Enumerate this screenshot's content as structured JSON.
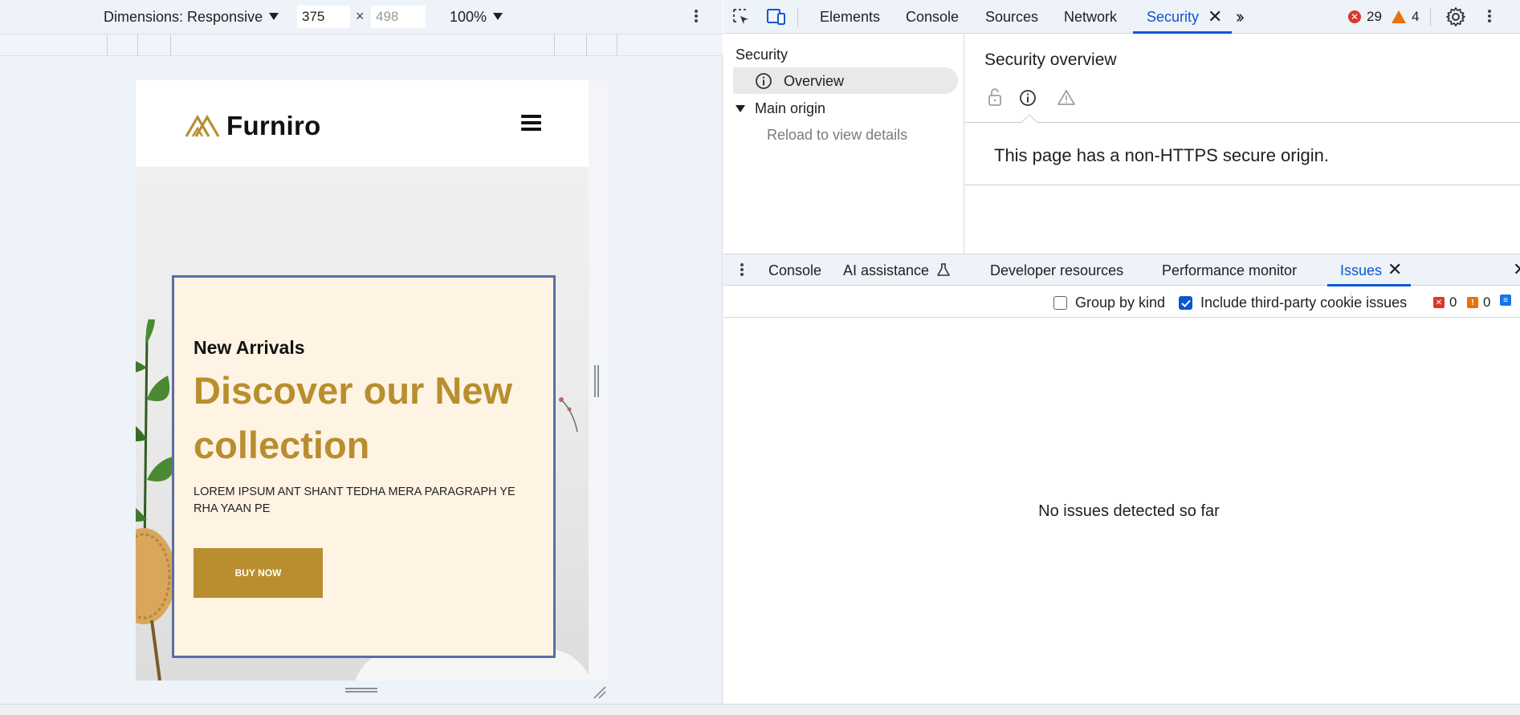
{
  "device_toolbar": {
    "dimensions_label": "Dimensions: Responsive",
    "width_value": "375",
    "height_placeholder": "498",
    "times_sign": "×",
    "zoom_value": "100%"
  },
  "site": {
    "logo_text": "Furniro",
    "brand_color": "#b88e2f",
    "eyebrow": "New Arrivals",
    "headline": "Discover our New collection",
    "description": "LOREM IPSUM ANT SHANT TEDHA MERA PARAGRAPH YE RHA YAAN PE",
    "cta_label": "BUY NOW",
    "card_bg": "#fff3e3",
    "card_border": "#5b6ea3"
  },
  "devtools": {
    "tabs": [
      {
        "label": "Elements"
      },
      {
        "label": "Console"
      },
      {
        "label": "Sources"
      },
      {
        "label": "Network"
      },
      {
        "label": "Security",
        "active": true
      }
    ],
    "error_count": "29",
    "warning_count": "4",
    "accent": "#0b57d0",
    "security": {
      "sidebar_title": "Security",
      "overview_label": "Overview",
      "main_origin_label": "Main origin",
      "reload_text": "Reload to view details",
      "panel_title": "Security overview",
      "message": "This page has a non-HTTPS secure origin."
    },
    "drawer": {
      "tabs": [
        {
          "label": "Console"
        },
        {
          "label": "AI assistance"
        },
        {
          "label": "Developer resources"
        },
        {
          "label": "Performance monitor"
        },
        {
          "label": "Issues",
          "active": true
        }
      ],
      "group_by_kind_label": "Group by kind",
      "group_by_kind_checked": false,
      "third_party_label": "Include third-party cookie issues",
      "third_party_checked": true,
      "issue_counts": [
        "0",
        "0"
      ],
      "empty_message": "No issues detected so far"
    }
  }
}
